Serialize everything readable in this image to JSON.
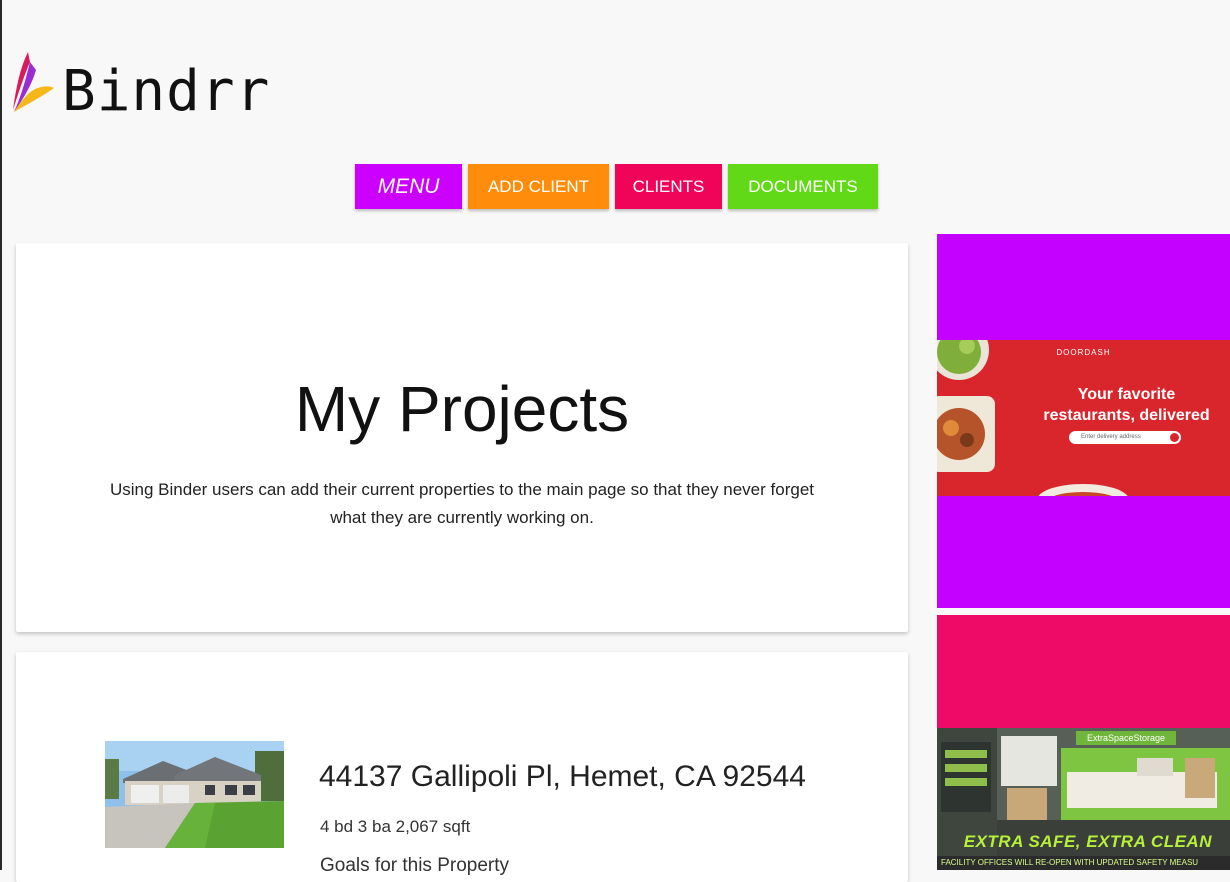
{
  "brand": {
    "name": "Bindrr"
  },
  "nav": {
    "menu": "MENU",
    "add_client": "ADD CLIENT",
    "clients": "CLIENTS",
    "documents": "DOCUMENTS"
  },
  "intro": {
    "title": "My Projects",
    "description": "Using Binder users can add their current properties to the main page so that they never forget what they are currently working on."
  },
  "project": {
    "address": "44137 Gallipoli Pl, Hemet, CA 92544",
    "specs": "4 bd 3 ba 2,067 sqft",
    "goals_label": "Goals for this Property"
  },
  "ads": {
    "doordash": {
      "brand": "DOORDASH",
      "headline": "Your favorite restaurants, delivered",
      "search_placeholder": "Enter delivery address"
    },
    "extra_space": {
      "sign": "ExtraSpaceStorage",
      "tagline": "EXTRA SAFE, EXTRA CLEAN",
      "subline": "FACILITY OFFICES WILL RE-OPEN WITH UPDATED SAFETY MEASU"
    }
  },
  "colors": {
    "menu": "#cc00ff",
    "add_client": "#ff8c0a",
    "clients": "#f0045a",
    "documents": "#62d916",
    "ad_purple": "#c400ff",
    "ad_pink": "#ee0a67"
  }
}
